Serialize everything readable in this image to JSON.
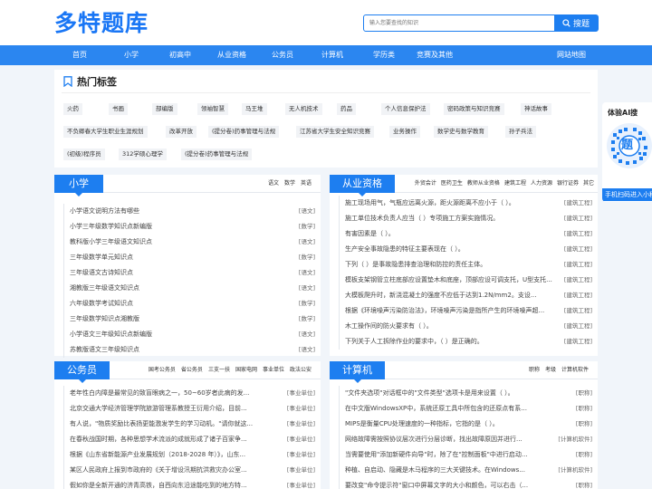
{
  "header": {
    "logo": "多特题库",
    "search_placeholder": "输入您要查找的知识",
    "search_button": "搜题"
  },
  "nav": [
    "首页",
    "小学",
    "初高中",
    "从业资格",
    "公务员",
    "计算机",
    "学历类",
    "竞赛及其他",
    "网站地图"
  ],
  "hot": {
    "title": "热门标签",
    "rows": [
      [
        "火药",
        "书画",
        "部编版",
        "领袖智慧",
        "马王堆",
        "无人机技术",
        "药品",
        "个人信息保护法",
        "密码政策与知识竞赛",
        "神话故事"
      ],
      [
        "不负卿春大学生职业生涯规划",
        "改革开放",
        "(提分卷)药事管理与法规",
        "江苏省大学生安全知识竞赛",
        "业务操作",
        "数学史与数学教育",
        "孙子兵法"
      ],
      [
        "(初级)程序员",
        "312学硕心理学",
        "(提分卷)药事管理与法规"
      ]
    ]
  },
  "panels": [
    {
      "title": "小学",
      "tags": [
        "语文",
        "数学",
        "英语"
      ],
      "rows": [
        {
          "t": "小学语文说明方法有哪些",
          "c": "[语文]"
        },
        {
          "t": "小学三年级数学知识点新编版",
          "c": "[数学]"
        },
        {
          "t": "教科版小学三年级语文知识点",
          "c": "[语文]"
        },
        {
          "t": "三年级数学单元知识点",
          "c": "[数学]"
        },
        {
          "t": "三年级语文古诗知识点",
          "c": "[语文]"
        },
        {
          "t": "湘教版三年级语文知识点",
          "c": "[语文]"
        },
        {
          "t": "六年级数学考试知识点",
          "c": "[数学]"
        },
        {
          "t": "三年级数学知识点湘教版",
          "c": "[数学]"
        },
        {
          "t": "小学语文三年级知识点新编版",
          "c": "[语文]"
        },
        {
          "t": "苏教版语文三年级知识点",
          "c": "[语文]"
        }
      ]
    },
    {
      "title": "从业资格",
      "tags": [
        "外贸会计",
        "医药卫生",
        "教师从业资格",
        "建筑工程",
        "人力资源",
        "银行证券",
        "其它"
      ],
      "rows": [
        {
          "t": "施工现场用气，气瓶应远离火源，距火源距离不应小于（  ）。",
          "c": "[建筑工程]"
        },
        {
          "t": "施工单位技术负责人应当（  ）专项施工方案实施情况。",
          "c": "[建筑工程]"
        },
        {
          "t": "有害因素是（  ）。",
          "c": "[建筑工程]"
        },
        {
          "t": "生产安全事故隐患的特征主要表现在（  ）。",
          "c": "[建筑工程]"
        },
        {
          "t": "下列（  ）是事故隐患排查治理和防控的责任主体。",
          "c": "[建筑工程]"
        },
        {
          "t": "模板支架钢管立柱底部应设置垫木和底座，顶部应设可调支托，U型支托...",
          "c": "[建筑工程]"
        },
        {
          "t": "大模板爬升时，新浇混凝土的强度不应低于达到1.2N/mm2。支设...",
          "c": "[建筑工程]"
        },
        {
          "t": "根据《环境噪声污染防治法》，环境噪声污染是指所产生的环境噪声超...",
          "c": "[建筑工程]"
        },
        {
          "t": "木工操作间的防火要求有（  ）。",
          "c": "[建筑工程]"
        },
        {
          "t": "下列关于人工拆除作业的要求中，（  ）是正确的。",
          "c": "[建筑工程]"
        }
      ]
    },
    {
      "title": "公务员",
      "tags": [
        "国考公务员",
        "省公务员",
        "三支一扶",
        "国家电网",
        "事业单位",
        "政法公安"
      ],
      "rows": [
        {
          "t": "老年性白内障是最常见的致盲眼病之一，50~60岁者此病的发...",
          "c": "[事业单位]"
        },
        {
          "t": "北京交通大学经济管理学院旅游管理系教授王衍用介绍，目前...",
          "c": "[事业单位]"
        },
        {
          "t": "有人说，\"物质奖励比表扬更能激发学生的学习动机。\"请你就这...",
          "c": "[事业单位]"
        },
        {
          "t": "在春秋战国时期，各种思想学术流派的成就形成了诸子百家争...",
          "c": "[事业单位]"
        },
        {
          "t": "根据《山东省新能源产业发展规划（2018-2028 年）》，山东...",
          "c": "[事业单位]"
        },
        {
          "t": "某区人民政府上报到市政府的《关于增设汛期抗洪救灾办公室...",
          "c": "[事业单位]"
        },
        {
          "t": "假如你是全新开通的济青高铁，自西向东沿途能吃到的地方特...",
          "c": "[事业单位]"
        }
      ]
    },
    {
      "title": "计算机",
      "tags": [
        "职称",
        "考级",
        "计算机软件"
      ],
      "rows": [
        {
          "t": "\"文件夹选项\"对话框中的\"文件类型\"选项卡是用来设置（  ）。",
          "c": "[职称]"
        },
        {
          "t": "在中文版WindowsXP中，系统还原工具中所包含的还原点有系...",
          "c": "[职称]"
        },
        {
          "t": "MIPS是衡量CPU处理速度的一种指标，它指的是（  ）。",
          "c": "[职称]"
        },
        {
          "t": "网络故障需按照协议层次进行分层诊断，找出故障原因并进行...",
          "c": "[计算机软件]"
        },
        {
          "t": "当需要使用\"添加新硬件向导\"时，除了在\"控制面板\"中进行启动...",
          "c": "[职称]"
        },
        {
          "t": "种植、自启动、隐藏是木马程序的三大关键技术。在Windows...",
          "c": "[计算机软件]"
        },
        {
          "t": "要改变\"命令提示符\"窗口中屏幕文字的大小和颜色，可以右击（...",
          "c": "[职称]"
        }
      ]
    }
  ],
  "ai_widget": {
    "title": "体验AI搜",
    "qr_label": "题",
    "footer": "手机扫码进入小程序"
  },
  "colors": {
    "brand": "#1d7ef0",
    "nav": "#2b86f0"
  }
}
